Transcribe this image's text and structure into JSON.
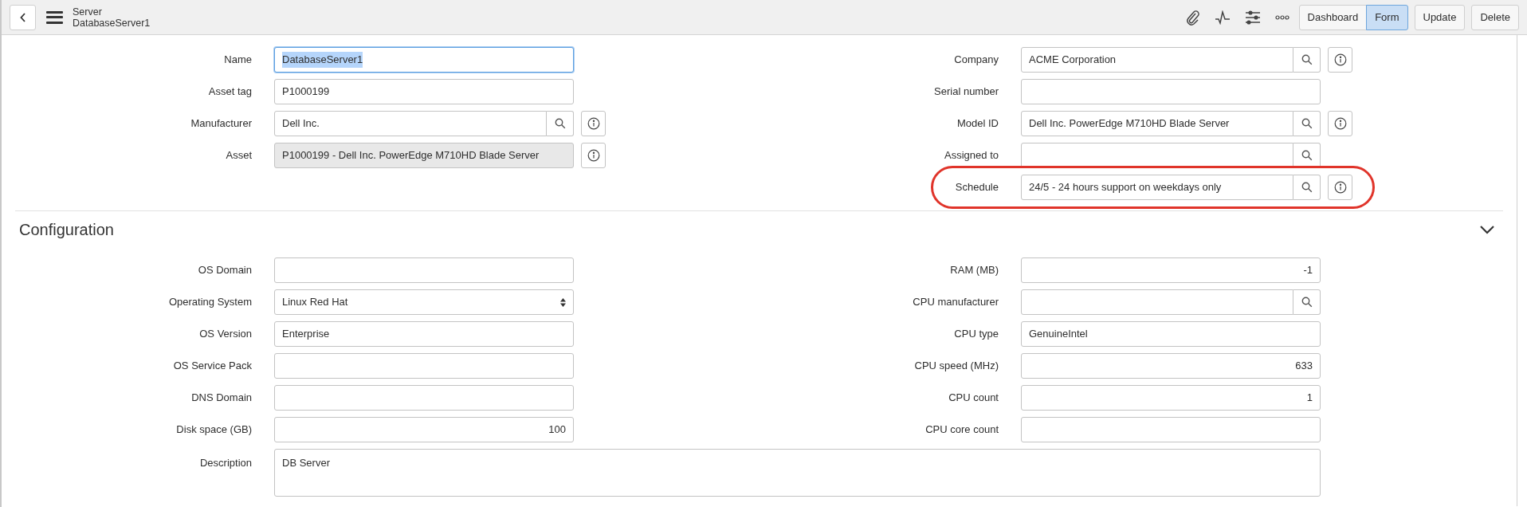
{
  "header": {
    "record_type": "Server",
    "record_name": "DatabaseServer1",
    "view_toggle": [
      {
        "label": "Dashboard",
        "selected": false
      },
      {
        "label": "Form",
        "selected": true
      }
    ],
    "actions": [
      "Update",
      "Delete"
    ]
  },
  "main_section": {
    "left": [
      {
        "label": "Name",
        "kind": "text",
        "value": "DatabaseServer1",
        "focused": true
      },
      {
        "label": "Asset tag",
        "kind": "text",
        "value": "P1000199"
      },
      {
        "label": "Manufacturer",
        "kind": "lookup",
        "value": "Dell Inc.",
        "info": true
      },
      {
        "label": "Asset",
        "kind": "readonly",
        "value": "P1000199 - Dell Inc. PowerEdge M710HD Blade Server",
        "info": true
      }
    ],
    "right": [
      {
        "label": "Company",
        "kind": "lookup",
        "value": "ACME Corporation",
        "info": true
      },
      {
        "label": "Serial number",
        "kind": "text"
      },
      {
        "label": "Model ID",
        "kind": "lookup",
        "value": "Dell Inc. PowerEdge M710HD Blade Server",
        "info": true
      },
      {
        "label": "Assigned to",
        "kind": "lookup"
      },
      {
        "label": "Schedule",
        "kind": "lookup",
        "value": "24/5 - 24 hours support on weekdays only",
        "info": true,
        "highlighted": true
      }
    ]
  },
  "configuration": {
    "title": "Configuration",
    "expanded": true,
    "left": [
      {
        "label": "OS Domain",
        "kind": "text"
      },
      {
        "label": "Operating System",
        "kind": "select",
        "value": "Linux Red Hat"
      },
      {
        "label": "OS Version",
        "kind": "text",
        "value": "Enterprise"
      },
      {
        "label": "OS Service Pack",
        "kind": "text"
      },
      {
        "label": "DNS Domain",
        "kind": "text"
      },
      {
        "label": "Disk space (GB)",
        "kind": "number",
        "value": "100"
      }
    ],
    "right": [
      {
        "label": "RAM (MB)",
        "kind": "number",
        "value": "-1"
      },
      {
        "label": "CPU manufacturer",
        "kind": "lookup"
      },
      {
        "label": "CPU type",
        "kind": "text",
        "value": "GenuineIntel"
      },
      {
        "label": "CPU speed (MHz)",
        "kind": "number",
        "value": "633"
      },
      {
        "label": "CPU count",
        "kind": "number",
        "value": "1"
      },
      {
        "label": "CPU core count",
        "kind": "number"
      }
    ],
    "wide": [
      {
        "label": "Description",
        "kind": "textarea",
        "value": "DB Server"
      }
    ]
  }
}
